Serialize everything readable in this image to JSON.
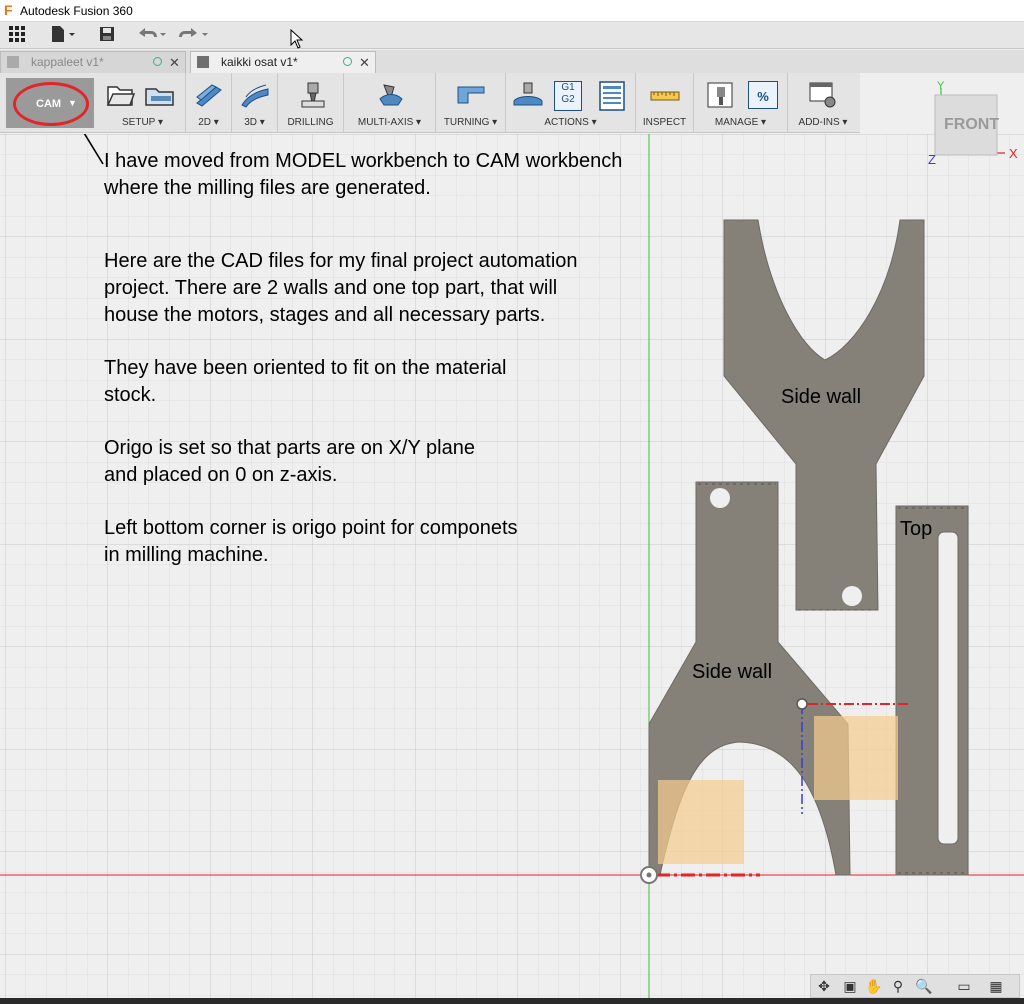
{
  "window": {
    "title": "Autodesk Fusion 360"
  },
  "tabs": [
    {
      "label": "kappaleet v1*",
      "active": false
    },
    {
      "label": "kaikki osat v1*",
      "active": true
    }
  ],
  "toolbar": {
    "workspace": "CAM",
    "groups": [
      {
        "label": "SETUP",
        "dropdown": true
      },
      {
        "label": "2D",
        "dropdown": true
      },
      {
        "label": "3D",
        "dropdown": true
      },
      {
        "label": "DRILLING",
        "dropdown": false
      },
      {
        "label": "MULTI-AXIS",
        "dropdown": true
      },
      {
        "label": "TURNING",
        "dropdown": true
      },
      {
        "label": "ACTIONS",
        "dropdown": true
      },
      {
        "label": "INSPECT",
        "dropdown": false
      },
      {
        "label": "MANAGE",
        "dropdown": true
      },
      {
        "label": "ADD-INS",
        "dropdown": true
      }
    ],
    "actions_g_codes": [
      "G1",
      "G2"
    ],
    "manage_percent": "%"
  },
  "notes": {
    "n1_l1": "I have moved from MODEL workbench to CAM workbench",
    "n1_l2": "where the milling files are generated.",
    "n2_l1": "Here are the CAD files for my final project automation",
    "n2_l2": "project. There are 2 walls and one top part, that will",
    "n2_l3": "house the motors, stages and all necessary parts.",
    "n3_l1": "They have been oriented to fit on the material",
    "n3_l2": "stock.",
    "n4_l1": "Origo is set so that parts are on X/Y plane",
    "n4_l2": "and placed on 0 on z-axis.",
    "n5_l1": "Left bottom corner is origo point for componets",
    "n5_l2": "in milling machine."
  },
  "parts": {
    "side_wall_upper": "Side wall",
    "side_wall_lower": "Side wall",
    "top": "Top"
  },
  "viewcube": {
    "face": "FRONT",
    "axis_x": "X",
    "axis_y": "Y",
    "axis_z": "Z"
  },
  "colors": {
    "part_fill": "#858078",
    "stock_fill": "#f5cd8e",
    "y_axis": "#3cbf3c",
    "x_axis": "#e0262b",
    "workspace_ring": "#e0262b"
  }
}
